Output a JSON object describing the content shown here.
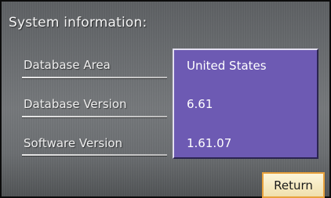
{
  "title": "System information:",
  "rows": [
    {
      "label": "Database Area",
      "value": "United States"
    },
    {
      "label": "Database Version",
      "value": "6.61"
    },
    {
      "label": "Software Version",
      "value": "1.61.07"
    }
  ],
  "return_button": {
    "label": "Return"
  },
  "colors": {
    "panel": "#6d5ab3",
    "button_border": "#e8a13c",
    "button_fill": "#f6ebc6"
  }
}
